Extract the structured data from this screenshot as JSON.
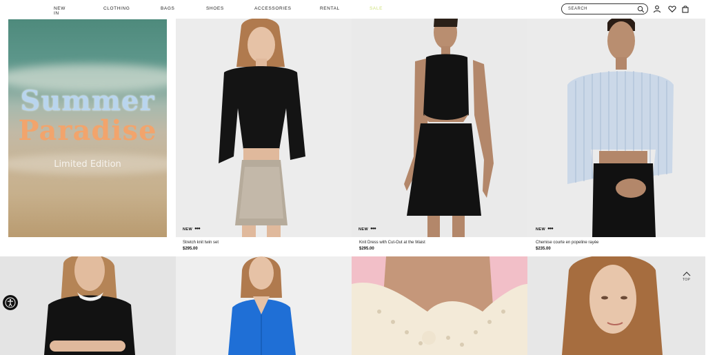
{
  "nav": {
    "items": [
      {
        "label": "NEW IN"
      },
      {
        "label": "CLOTHING"
      },
      {
        "label": "BAGS"
      },
      {
        "label": "SHOES"
      },
      {
        "label": "ACCESSORIES"
      },
      {
        "label": "RENTAL"
      },
      {
        "label": "SALE"
      }
    ],
    "search_placeholder": "SEARCH",
    "accent_sale_color": "#cfe27a"
  },
  "icons": [
    "search-icon",
    "user-icon",
    "heart-icon",
    "bag-icon",
    "chevron-up-icon",
    "accessibility-icon"
  ],
  "promo": {
    "title_line1": "Summer",
    "title_line2": "Paradise",
    "subtitle": "Limited Edition"
  },
  "products": [
    {
      "badge": "NEW",
      "name": "Stretch knit twin set",
      "price": "$295.00"
    },
    {
      "badge": "NEW",
      "name": "Knit Dress with Cut-Out at the Waist",
      "price": "$295.00"
    },
    {
      "badge": "NEW",
      "name": "Chemise courte en popeline rayée",
      "price": "$235.00"
    }
  ],
  "back_to_top": {
    "label": "TOP"
  }
}
